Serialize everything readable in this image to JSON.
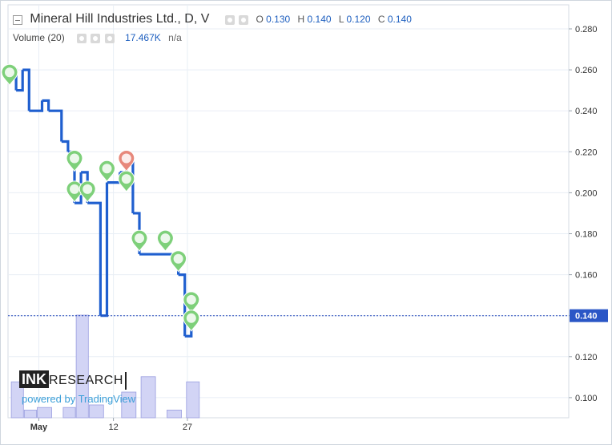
{
  "legend": {
    "title": "Mineral Hill Industries Ltd., D, V",
    "o_label": "O",
    "o_value": "0.130",
    "h_label": "H",
    "h_value": "0.140",
    "l_label": "L",
    "l_value": "0.120",
    "c_label": "C",
    "c_value": "0.140",
    "volume_label": "Volume (20)",
    "volume_value": "17.467K",
    "volume_extra": "n/a",
    "icons": [
      "eye-icon",
      "gear-icon",
      "close-icon"
    ]
  },
  "logo": {
    "ink": "INK",
    "research": "RESEARCH",
    "powered": "powered by TradingView"
  },
  "chart_data": {
    "type": "line",
    "style": "step-line",
    "y_ticks": [
      "0.280",
      "0.260",
      "0.240",
      "0.220",
      "0.200",
      "0.180",
      "0.160",
      "0.140",
      "0.120",
      "0.100"
    ],
    "y_range": [
      0.09,
      0.288
    ],
    "x_ticks": [
      "May",
      "12",
      "27"
    ],
    "current_price_label": "0.140",
    "current_price": 0.14,
    "colors": {
      "price": "#1f5fcf",
      "volume": "#d2d4f5",
      "volume_edge": "#9a9ee0",
      "grid": "#e8eef5",
      "buy_marker": "#7ed07a",
      "sell_marker": "#e7887b",
      "price_line": "#2a4dbb"
    },
    "series": [
      {
        "values": [
          {
            "d": 0,
            "v": 0.26
          },
          {
            "d": 1,
            "v": 0.25
          },
          {
            "d": 2,
            "v": 0.26
          },
          {
            "d": 3,
            "v": 0.24
          },
          {
            "d": 5,
            "v": 0.245
          },
          {
            "d": 6,
            "v": 0.24
          },
          {
            "d": 8,
            "v": 0.225
          },
          {
            "d": 9,
            "v": 0.22
          },
          {
            "d": 10,
            "v": 0.195
          },
          {
            "d": 11,
            "v": 0.21
          },
          {
            "d": 12,
            "v": 0.195
          },
          {
            "d": 13,
            "v": 0.195
          },
          {
            "d": 14,
            "v": 0.14
          },
          {
            "d": 15,
            "v": 0.205
          },
          {
            "d": 16,
            "v": 0.205
          },
          {
            "d": 17,
            "v": 0.21
          },
          {
            "d": 18,
            "v": 0.215
          },
          {
            "d": 19,
            "v": 0.19
          },
          {
            "d": 20,
            "v": 0.17
          },
          {
            "d": 21,
            "v": 0.17
          },
          {
            "d": 22,
            "v": 0.17
          },
          {
            "d": 23,
            "v": 0.17
          },
          {
            "d": 24,
            "v": 0.17
          },
          {
            "d": 25,
            "v": 0.17
          },
          {
            "d": 26,
            "v": 0.16
          },
          {
            "d": 27,
            "v": 0.13
          },
          {
            "d": 28,
            "v": 0.14
          }
        ]
      }
    ],
    "volume": [
      {
        "d": 1,
        "v": 14
      },
      {
        "d": 3,
        "v": 3
      },
      {
        "d": 5,
        "v": 4
      },
      {
        "d": 9,
        "v": 4
      },
      {
        "d": 11,
        "v": 40
      },
      {
        "d": 13,
        "v": 5
      },
      {
        "d": 18,
        "v": 10
      },
      {
        "d": 21,
        "v": 16
      },
      {
        "d": 25,
        "v": 3
      },
      {
        "d": 28,
        "v": 14
      }
    ],
    "markers": [
      {
        "d": 0,
        "v": 0.258,
        "kind": "buy"
      },
      {
        "d": 10,
        "v": 0.216,
        "kind": "buy"
      },
      {
        "d": 10,
        "v": 0.201,
        "kind": "buy"
      },
      {
        "d": 12,
        "v": 0.201,
        "kind": "buy"
      },
      {
        "d": 15,
        "v": 0.211,
        "kind": "buy"
      },
      {
        "d": 18,
        "v": 0.216,
        "kind": "sell"
      },
      {
        "d": 18,
        "v": 0.206,
        "kind": "buy"
      },
      {
        "d": 20,
        "v": 0.177,
        "kind": "buy"
      },
      {
        "d": 24,
        "v": 0.177,
        "kind": "buy"
      },
      {
        "d": 26,
        "v": 0.167,
        "kind": "buy"
      },
      {
        "d": 28,
        "v": 0.147,
        "kind": "buy"
      },
      {
        "d": 28,
        "v": 0.138,
        "kind": "buy"
      }
    ]
  }
}
